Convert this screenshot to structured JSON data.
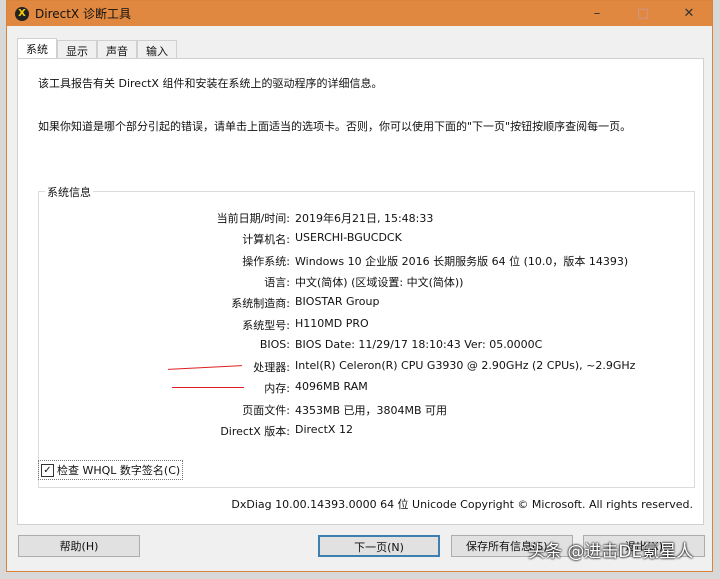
{
  "window": {
    "title": "DirectX 诊断工具",
    "minimize": "–",
    "maximize": "□",
    "close": "✕"
  },
  "tabs": [
    "系统",
    "显示",
    "声音",
    "输入"
  ],
  "intro1": "该工具报告有关 DirectX 组件和安装在系统上的驱动程序的详细信息。",
  "intro2": "如果你知道是哪个部分引起的错误，请单击上面适当的选项卡。否则，你可以使用下面的\"下一页\"按钮按顺序查阅每一页。",
  "system_info": {
    "label": "系统信息",
    "rows": [
      {
        "k": "当前日期/时间:",
        "v": "2019年6月21日, 15:48:33"
      },
      {
        "k": "计算机名:",
        "v": "USERCHI-BGUCDCK"
      },
      {
        "k": "操作系统:",
        "v": "Windows 10 企业版 2016 长期服务版 64 位 (10.0，版本 14393)"
      },
      {
        "k": "语言:",
        "v": "中文(简体) (区域设置: 中文(简体))"
      },
      {
        "k": "系统制造商:",
        "v": "BIOSTAR Group"
      },
      {
        "k": "系统型号:",
        "v": "H110MD PRO"
      },
      {
        "k": "BIOS:",
        "v": "BIOS Date: 11/29/17 18:10:43 Ver: 05.0000C"
      },
      {
        "k": "处理器:",
        "v": "Intel(R) Celeron(R) CPU G3930 @ 2.90GHz (2 CPUs), ~2.9GHz"
      },
      {
        "k": "内存:",
        "v": "4096MB RAM"
      },
      {
        "k": "页面文件:",
        "v": "4353MB 已用，3804MB 可用"
      },
      {
        "k": "DirectX 版本:",
        "v": "DirectX 12"
      }
    ]
  },
  "whql": "检查 WHQL 数字签名(C)",
  "footer": "DxDiag 10.00.14393.0000 64 位 Unicode  Copyright © Microsoft. All rights reserved.",
  "buttons": {
    "help": "帮助(H)",
    "next": "下一页(N)",
    "save": "保存所有信息(S)...",
    "exit": "退出(X)"
  },
  "watermark": "头条 @进击DE氪星人"
}
